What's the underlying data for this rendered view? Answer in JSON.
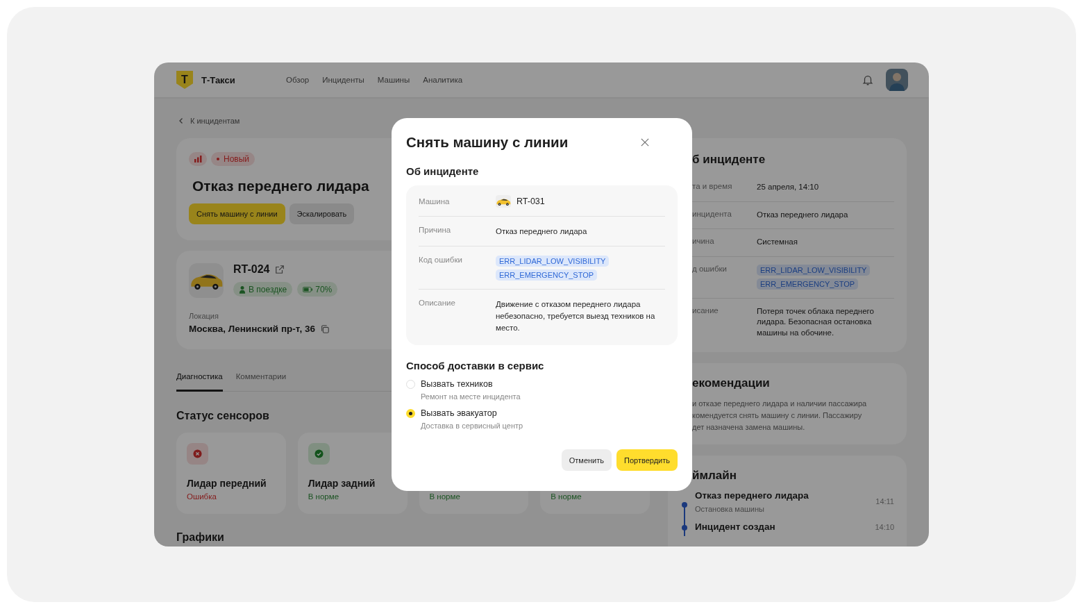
{
  "header": {
    "logo_letter": "Т",
    "brand": "Т-Такси",
    "nav": [
      {
        "label": "Обзор",
        "selected": false
      },
      {
        "label": "Инциденты",
        "selected": false
      },
      {
        "label": "Машины",
        "selected": false
      },
      {
        "label": "Аналитика",
        "selected": false
      }
    ]
  },
  "back_link": "К инцидентам",
  "incident": {
    "status_badge": "Новый",
    "title": "Отказ переднего лидара",
    "buttons": [
      {
        "label": "Снять машину с линии",
        "kind": "primary"
      },
      {
        "label": "Эскалировать",
        "kind": "secondary"
      }
    ]
  },
  "vehicle": {
    "id": "RT-024",
    "trip_status": "В поездке",
    "battery": "70%",
    "location_label": "Локация",
    "location": "Москва, Ленинский пр-т, 36"
  },
  "tabs": [
    {
      "label": "Диагностика",
      "selected": true
    },
    {
      "label": "Комментарии",
      "selected": false
    }
  ],
  "sensors": {
    "title": "Статус сенсоров",
    "items": [
      {
        "name": "Лидар передний",
        "status": "Ошибка",
        "ok": false
      },
      {
        "name": "Лидар задний",
        "status": "В норме",
        "ok": true
      },
      {
        "status": "В норме",
        "ok": true
      },
      {
        "status": "В норме",
        "ok": true
      }
    ]
  },
  "charts_title": "Графики",
  "details_panel": {
    "title": "б инциденте",
    "rows": [
      {
        "kind": "text",
        "label": "та и время",
        "value": "25 апреля, 14:10"
      },
      {
        "kind": "text",
        "label": "инцидента",
        "value": "Отказ переднего лидара"
      },
      {
        "kind": "text",
        "label": "ичина",
        "value": "Системная"
      },
      {
        "kind": "codes",
        "label": "д ошибки",
        "codes": [
          "ERR_LIDAR_LOW_VISIBILITY",
          "ERR_EMERGENCY_STOP"
        ]
      },
      {
        "kind": "text",
        "label": "исание",
        "value": "Потеря точек облака переднего лидара. Безопасная остановка машины на обочине."
      }
    ]
  },
  "recommendations": {
    "title": "екомендации",
    "lines": [
      "и отказе переднего лидара и наличии пассажира",
      "комендуется снять машину с линии. Пассажиру",
      "дет назначена замена машины."
    ]
  },
  "timeline": {
    "title": "ймлайн",
    "events": [
      {
        "title": "Отказ переднего лидара",
        "subtitle": "Остановка машины",
        "time": "14:11"
      },
      {
        "title": "Инцидент создан",
        "time": "14:10"
      }
    ]
  },
  "modal": {
    "title": "Снять машину с линии",
    "section_title": "Об инциденте",
    "rows": [
      {
        "kind": "vehicle",
        "label": "Машина",
        "value": "RT-031"
      },
      {
        "kind": "text",
        "label": "Причина",
        "value": "Отказ переднего лидара"
      },
      {
        "kind": "codes",
        "label": "Код ошибки",
        "codes": [
          "ERR_LIDAR_LOW_VISIBILITY",
          "ERR_EMERGENCY_STOP"
        ]
      },
      {
        "kind": "text",
        "label": "Описание",
        "value": "Движение с отказом переднего лидара небезопасно, требуется выезд техников на место."
      }
    ],
    "delivery_title": "Способ доставки в сервис",
    "options": [
      {
        "label": "Вызвать техников",
        "hint": "Ремонт на месте инцидента",
        "selected": false
      },
      {
        "label": "Вызвать эвакуатор",
        "hint": "Доставка в сервисный центр",
        "selected": true
      }
    ],
    "buttons": [
      {
        "label": "Отменить",
        "kind": "secondary"
      },
      {
        "label": "Портвердить",
        "kind": "primary"
      }
    ]
  }
}
